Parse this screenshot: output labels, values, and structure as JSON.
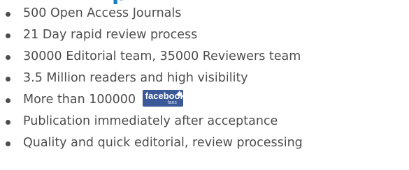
{
  "heading": {
    "visible_fragment": "p"
  },
  "features": [
    {
      "text": "500 Open Access Journals"
    },
    {
      "text": "21 Day rapid review process"
    },
    {
      "text": "30000 Editorial team, 35000 Reviewers team"
    },
    {
      "text": "3.5 Million readers and high visibility"
    },
    {
      "text": "More than 100000",
      "badge": {
        "word": "facebook",
        "sub": "fans",
        "icon": "thumbs-up-icon",
        "color": "#3b5998"
      }
    },
    {
      "text": "Publication immediately after acceptance"
    },
    {
      "text": "Quality and quick editorial, review processing"
    }
  ],
  "colors": {
    "text": "#4d4d4d",
    "heading": "#1a7fc2"
  }
}
